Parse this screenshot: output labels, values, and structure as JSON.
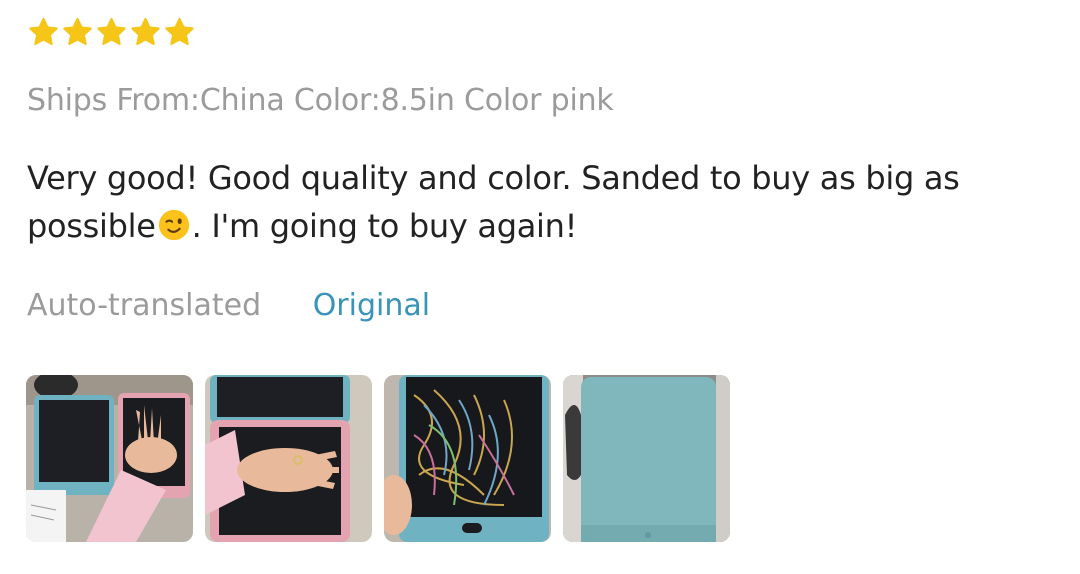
{
  "review": {
    "rating": 5,
    "rating_max": 5,
    "star_color": "#f5c518",
    "sku_text": "Ships From:China Color:8.5in Color pink",
    "body_part1": "Very good! Good quality and color. Sanded to buy as big as possible",
    "body_emoji": "winking-face-icon",
    "body_part2": ". I'm going to buy again!",
    "translation_label": "Auto-translated",
    "original_link": "Original",
    "link_color": "#3a94b8",
    "photos": [
      {
        "name": "review-photo-1"
      },
      {
        "name": "review-photo-2"
      },
      {
        "name": "review-photo-3"
      },
      {
        "name": "review-photo-4"
      }
    ]
  }
}
